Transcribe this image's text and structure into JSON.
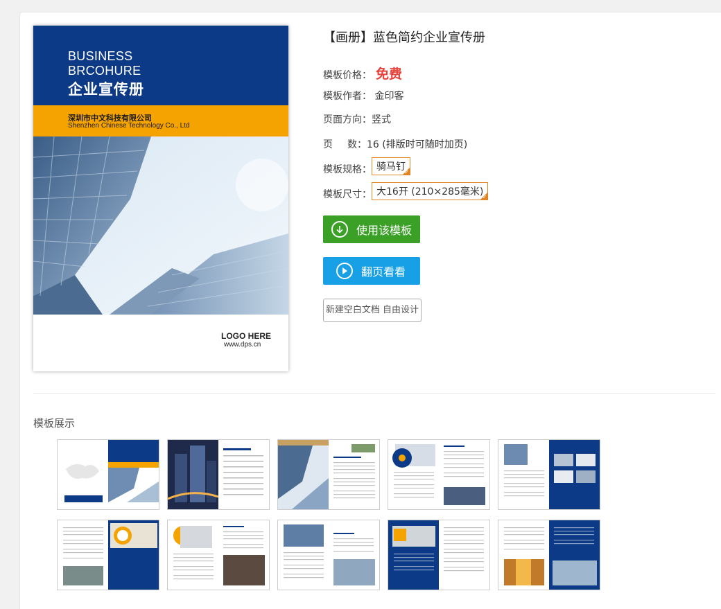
{
  "cover": {
    "en_line1": "BUSINESS",
    "en_line2": "BRCOHURE",
    "cn_title": "企业宣传册",
    "company_cn": "深圳市中文科技有限公司",
    "company_en": "Shenzhen Chinese Technology Co., Ltd",
    "logo_text": "LOGO HERE",
    "url_text": "www.dps.cn"
  },
  "info": {
    "title": "【画册】蓝色简约企业宣传册",
    "price_label": "模板价格：",
    "price_value": "免费",
    "author_label": "模板作者：",
    "author_value": "金印客",
    "orientation_label": "页面方向：",
    "orientation_value": "竖式",
    "pages_label_1": "页",
    "pages_label_2": "数：",
    "pages_value": "16 (排版时可随时加页)",
    "spec_label": "模板规格：",
    "spec_value": "骑马钉",
    "size_label": "模板尺寸：",
    "size_value": "大16开 (210×285毫米)"
  },
  "actions": {
    "use_template": "使用该模板",
    "flip_view": "翻页看看",
    "new_blank": "新建空白文档 自由设计"
  },
  "preview": {
    "section_title": "模板展示"
  },
  "colors": {
    "navy": "#0d3a86",
    "orange": "#f5a300",
    "green_button": "#3aa126",
    "blue_button": "#18a0e6",
    "price_red": "#e8413a",
    "option_border": "#e08424"
  }
}
